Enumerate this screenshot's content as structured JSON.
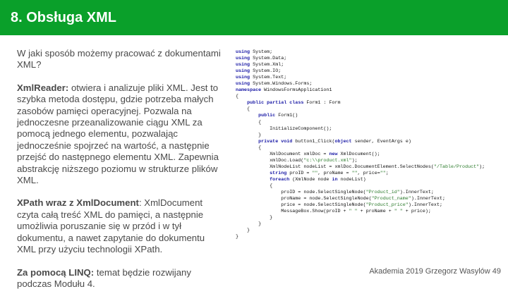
{
  "header": {
    "title": "8. Obsługa XML"
  },
  "intro": "W jaki sposób możemy pracować z dokumentami XML?",
  "sections": [
    {
      "term": "XmlReader:",
      "text": " otwiera i analizuje pliki XML. Jest to szybka metoda dostępu, gdzie potrzeba małych zasobów pamięci operacyjnej. Pozwala na jednoczesne przeanalizowanie ciągu XML za pomocą jednego elementu, pozwalając jednocześnie spojrzeć na wartość, a następnie przejść do następnego elementu XML. Zapewnia abstrakcję niższego poziomu w strukturze plików XML."
    },
    {
      "term": "XPath wraz z  XmlDocument",
      "text": ": XmlDocument czyta całą treść XML do pamięci, a następnie umożliwia poruszanie się w przód i w tył dokumentu, a nawet zapytanie do dokumentu XML przy użyciu technologii XPath."
    },
    {
      "term": "Za pomocą LINQ:",
      "text": " temat będzie rozwijany podczas Modułu 4."
    }
  ],
  "code_lines": [
    "using System;",
    "using System.Data;",
    "using System.Xml;",
    "using System.IO;",
    "using System.Text;",
    "using System.Windows.Forms;",
    "namespace WindowsFormsApplication1",
    "{",
    "    public partial class Form1 : Form",
    "    {",
    "        public Form1()",
    "        {",
    "            InitializeComponent();",
    "        }",
    "        private void button1_Click(object sender, EventArgs e)",
    "        {",
    "            XmlDocument xmlDoc = new XmlDocument();",
    "            xmlDoc.Load(\"c:\\\\product.xml\");",
    "            XmlNodeList nodeList = xmlDoc.DocumentElement.SelectNodes(\"/Table/Product\");",
    "            string proID = \"\", proName = \"\", price=\"\";",
    "            foreach (XmlNode node in nodeList)",
    "            {",
    "                proID = node.SelectSingleNode(\"Product_id\").InnerText;",
    "                proName = node.SelectSingleNode(\"Product_name\").InnerText;",
    "                price = node.SelectSingleNode(\"Product_price\").InnerText;",
    "                MessageBox.Show(proID + \" \" + proName + \" \" + price);",
    "            }",
    "        }",
    "    }",
    "}"
  ],
  "footer": "Akademia 2019 Grzegorz Wasylów 49"
}
